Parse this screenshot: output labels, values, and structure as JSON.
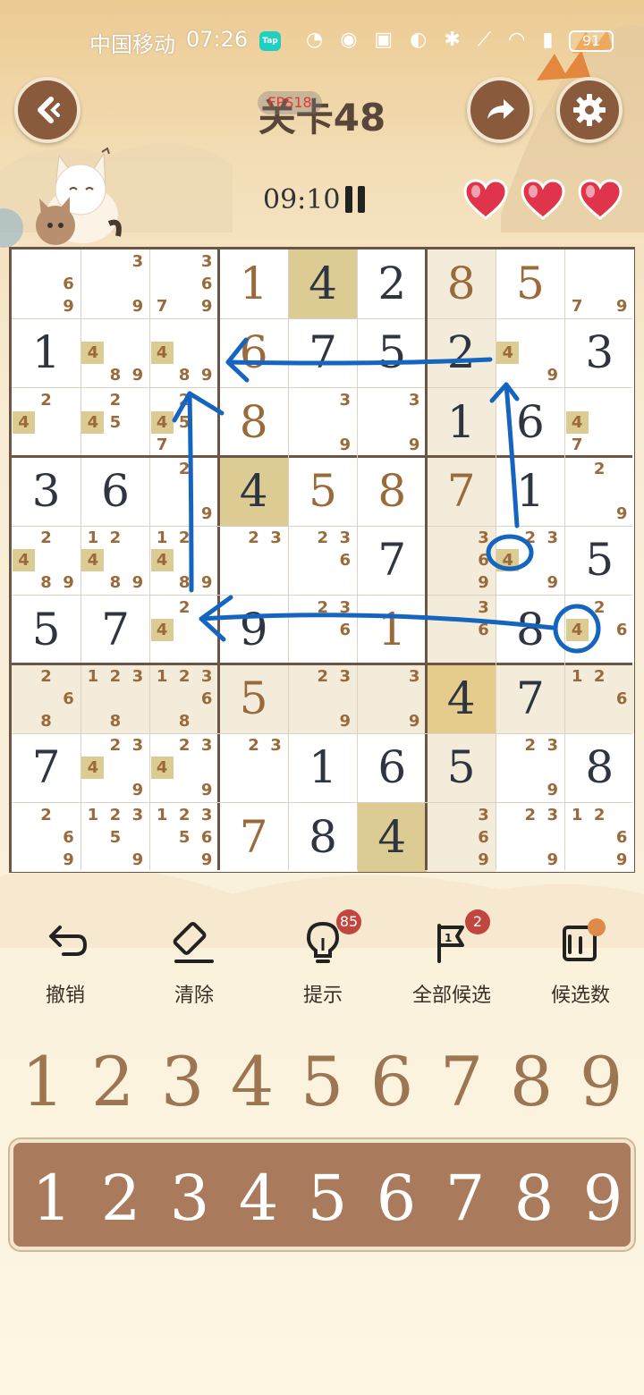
{
  "status_bar": {
    "carrier": "中国移动",
    "time": "07:26",
    "tap_badge": "Tap",
    "battery": "91"
  },
  "header": {
    "title": "关卡48",
    "fps_label": "FPS18",
    "back_icon": "back-chevron-icon",
    "share_icon": "share-arrow-icon",
    "settings_icon": "gear-icon"
  },
  "game_info": {
    "timer": "09:10",
    "lives_count": 3
  },
  "board": {
    "highlight_color": "#dccb93",
    "shade_color": "#f4ecdb",
    "given_colors": {
      "dark": "#2f3540",
      "brown": "#9a6a3a"
    },
    "cells": [
      [
        {
          "n": [
            6,
            9
          ]
        },
        {
          "n": [
            3,
            9
          ]
        },
        {
          "n": [
            3,
            6,
            7,
            9
          ]
        },
        {
          "v": "1",
          "c": "brown"
        },
        {
          "v": "4",
          "c": "dark",
          "bg": "gold"
        },
        {
          "v": "2",
          "c": "dark"
        },
        {
          "v": "8",
          "c": "brown"
        },
        {
          "v": "5",
          "c": "brown"
        },
        {
          "n": [
            7,
            9
          ]
        }
      ],
      [
        {
          "v": "1",
          "c": "dark"
        },
        {
          "n": [
            4,
            8,
            9
          ],
          "h": [
            4
          ]
        },
        {
          "n": [
            4,
            8,
            9
          ],
          "h": [
            4
          ]
        },
        {
          "v": "6",
          "c": "brown"
        },
        {
          "v": "7",
          "c": "dark"
        },
        {
          "v": "5",
          "c": "dark"
        },
        {
          "v": "2",
          "c": "dark"
        },
        {
          "n": [
            4,
            9
          ],
          "h": [
            4
          ]
        },
        {
          "v": "3",
          "c": "dark"
        }
      ],
      [
        {
          "n": [
            2,
            4
          ],
          "h": [
            4
          ]
        },
        {
          "n": [
            2,
            4,
            5
          ],
          "h": [
            4
          ]
        },
        {
          "n": [
            2,
            4,
            5,
            7
          ],
          "h": [
            4
          ]
        },
        {
          "v": "8",
          "c": "brown"
        },
        {
          "n": [
            3,
            9
          ]
        },
        {
          "n": [
            3,
            9
          ]
        },
        {
          "v": "1",
          "c": "dark"
        },
        {
          "v": "6",
          "c": "dark"
        },
        {
          "n": [
            4,
            7
          ],
          "h": [
            4
          ]
        }
      ],
      [
        {
          "v": "3",
          "c": "dark"
        },
        {
          "v": "6",
          "c": "dark"
        },
        {
          "n": [
            2,
            9
          ]
        },
        {
          "v": "4",
          "c": "dark",
          "bg": "gold"
        },
        {
          "v": "5",
          "c": "brown"
        },
        {
          "v": "8",
          "c": "brown"
        },
        {
          "v": "7",
          "c": "brown"
        },
        {
          "v": "1",
          "c": "dark"
        },
        {
          "n": [
            2,
            9
          ]
        }
      ],
      [
        {
          "n": [
            2,
            4,
            8,
            9
          ],
          "h": [
            4
          ]
        },
        {
          "n": [
            1,
            2,
            4,
            8,
            9
          ],
          "h": [
            4
          ]
        },
        {
          "n": [
            1,
            2,
            4,
            8,
            9
          ],
          "h": [
            4
          ]
        },
        {
          "n": [
            2,
            3
          ]
        },
        {
          "n": [
            2,
            3,
            6
          ]
        },
        {
          "v": "7",
          "c": "dark"
        },
        {
          "n": [
            3,
            6,
            9
          ]
        },
        {
          "n": [
            2,
            3,
            4,
            9
          ],
          "h": [
            4
          ]
        },
        {
          "v": "5",
          "c": "dark"
        }
      ],
      [
        {
          "v": "5",
          "c": "dark"
        },
        {
          "v": "7",
          "c": "dark"
        },
        {
          "n": [
            2,
            4
          ],
          "h": [
            4
          ]
        },
        {
          "v": "9",
          "c": "dark"
        },
        {
          "n": [
            2,
            3,
            6
          ]
        },
        {
          "v": "1",
          "c": "brown"
        },
        {
          "n": [
            3,
            6
          ]
        },
        {
          "v": "8",
          "c": "dark"
        },
        {
          "n": [
            2,
            4,
            6
          ],
          "h": [
            4
          ]
        }
      ],
      [
        {
          "n": [
            2,
            6,
            8
          ]
        },
        {
          "n": [
            1,
            2,
            3,
            8
          ]
        },
        {
          "n": [
            1,
            2,
            3,
            6,
            8
          ]
        },
        {
          "v": "5",
          "c": "brown"
        },
        {
          "n": [
            2,
            3,
            9
          ]
        },
        {
          "n": [
            3,
            9
          ]
        },
        {
          "v": "4",
          "c": "dark",
          "bg": "gold"
        },
        {
          "v": "7",
          "c": "dark"
        },
        {
          "n": [
            1,
            2,
            6
          ]
        }
      ],
      [
        {
          "v": "7",
          "c": "dark"
        },
        {
          "n": [
            2,
            3,
            4,
            9
          ],
          "h": [
            4
          ]
        },
        {
          "n": [
            2,
            3,
            4,
            9
          ],
          "h": [
            4
          ]
        },
        {
          "n": [
            2,
            3
          ]
        },
        {
          "v": "1",
          "c": "dark"
        },
        {
          "v": "6",
          "c": "dark"
        },
        {
          "v": "5",
          "c": "dark"
        },
        {
          "n": [
            2,
            3,
            9
          ]
        },
        {
          "v": "8",
          "c": "dark"
        }
      ],
      [
        {
          "n": [
            2,
            6,
            9
          ]
        },
        {
          "n": [
            1,
            2,
            3,
            5,
            9
          ]
        },
        {
          "n": [
            1,
            2,
            3,
            5,
            6,
            9
          ]
        },
        {
          "v": "7",
          "c": "brown"
        },
        {
          "v": "8",
          "c": "dark"
        },
        {
          "v": "4",
          "c": "dark",
          "bg": "gold"
        },
        {
          "n": [
            3,
            6,
            9
          ]
        },
        {
          "n": [
            2,
            3,
            9
          ]
        },
        {
          "n": [
            1,
            2,
            6,
            9
          ]
        }
      ]
    ]
  },
  "tools": [
    {
      "label": "撤销",
      "icon": "undo-icon"
    },
    {
      "label": "清除",
      "icon": "eraser-icon"
    },
    {
      "label": "提示",
      "icon": "lightbulb-icon",
      "badge": "85"
    },
    {
      "label": "全部候选",
      "icon": "flag-icon",
      "badge": "2"
    },
    {
      "label": "候选数",
      "icon": "pencil-notes-icon"
    }
  ],
  "number_row": [
    "1",
    "2",
    "3",
    "4",
    "5",
    "6",
    "7",
    "8",
    "9"
  ],
  "number_bar": [
    "1",
    "2",
    "3",
    "4",
    "5",
    "6",
    "7",
    "8",
    "9"
  ],
  "annotation_color": "#1565c0"
}
